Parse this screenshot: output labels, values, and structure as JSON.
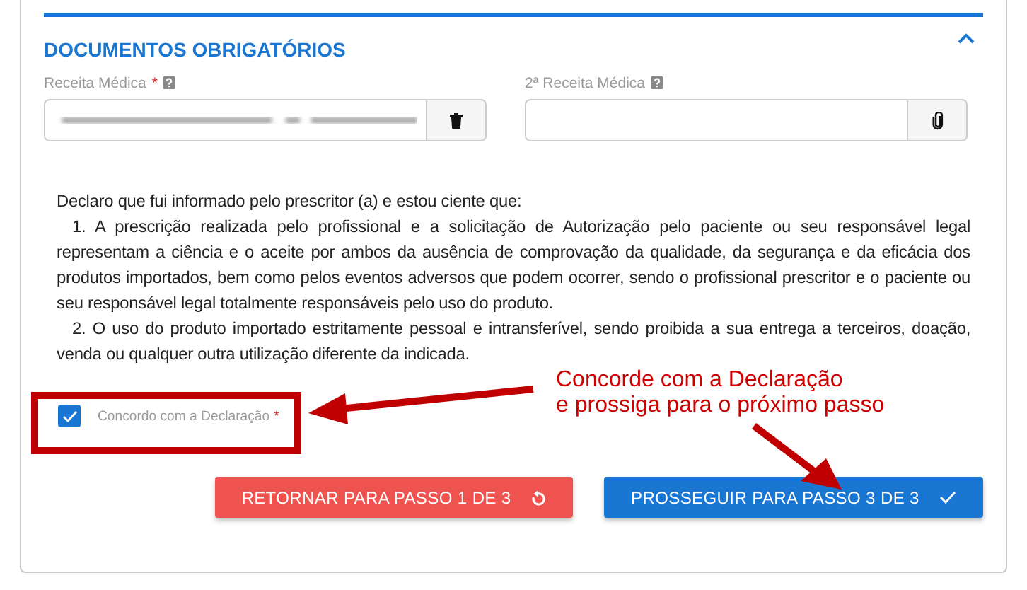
{
  "section": {
    "title": "DOCUMENTOS OBRIGATÓRIOS",
    "expanded": true
  },
  "fields": [
    {
      "label": "Receita Médica",
      "required": true,
      "required_mark": "*",
      "filled": true,
      "kind": "delete"
    },
    {
      "label": "2ª Receita Médica",
      "required": false,
      "filled": false,
      "kind": "attach"
    }
  ],
  "declaration": {
    "intro": "Declaro que fui informado pelo prescritor (a) e estou ciente que:",
    "items": [
      "1. A prescrição realizada pelo profissional e a solicitação de Autorização pelo paciente ou seu responsável legal representam a ciência e o aceite por ambos da ausência de comprovação da qualidade, da segurança e da eficácia dos produtos importados, bem como pelos eventos adversos que podem ocorrer, sendo o profissional prescritor e o paciente ou seu responsável legal totalmente responsáveis pelo uso do produto.",
      "2. O uso do produto importado estritamente pessoal e intransferível, sendo proibida a sua entrega a terceiros, doação, venda ou qualquer outra utilização diferente da indicada."
    ]
  },
  "agree": {
    "label": "Concordo com a Declaração",
    "required_mark": "*",
    "checked": true
  },
  "buttons": [
    {
      "label": "RETORNAR PARA PASSO 1 DE 3",
      "kind": "back"
    },
    {
      "label": "PROSSEGUIR PARA PASSO 3 DE 3",
      "kind": "next"
    }
  ],
  "annotation": {
    "lines": [
      "Concorde com a Declaração",
      "e prossiga para o próximo passo"
    ]
  }
}
